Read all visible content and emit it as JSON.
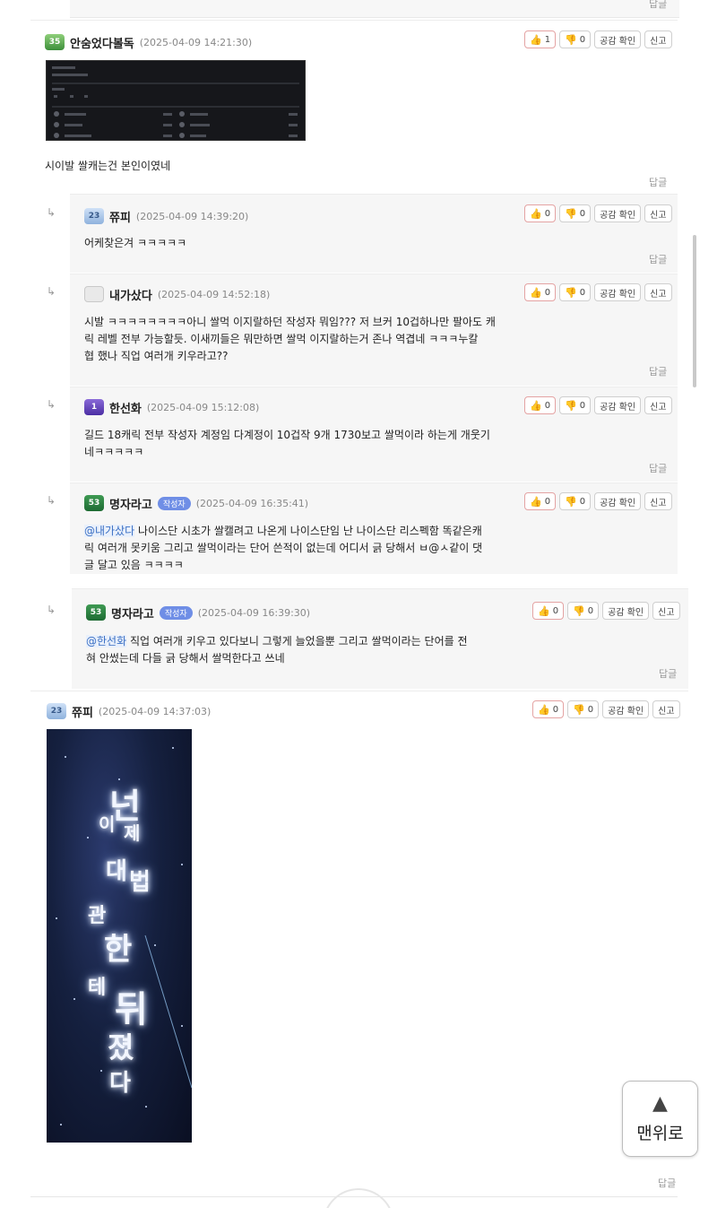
{
  "reply_label": "답글",
  "to_top": {
    "icon": "▲",
    "label": "맨위로"
  },
  "buttons": {
    "confirm": "공감 확인",
    "report": "신고",
    "like_icon": "thumbs-up-icon",
    "dislike_icon": "thumbs-down-icon"
  },
  "author_badge": "작성자",
  "comments": [
    {
      "level": "35",
      "nick": "안숨었다볼독",
      "date": "(2025-04-09 14:21:30)",
      "likes": "1",
      "dislikes": "0",
      "text": "시이발 쌀캐는건 본인이였네"
    },
    {
      "level": "23",
      "nick": "쮸피",
      "date": "(2025-04-09 14:39:20)",
      "likes": "0",
      "dislikes": "0",
      "text": "어케찾은겨 ㅋㅋㅋㅋㅋ"
    },
    {
      "level": "",
      "nick": "내가샀다",
      "date": "(2025-04-09 14:52:18)",
      "likes": "0",
      "dislikes": "0",
      "lines": [
        "시발 ㅋㅋㅋㅋㅋㅋㅋㅋ아니 쌀먹 이지랄하던 작성자 뭐임??? 저 브커 10겁하나만 팔아도 캐",
        "릭 레벨 전부 가능할듯. 이새끼들은 뭐만하면 쌀먹 이지랄하는거 존나 역겹네 ㅋㅋㅋ누칼",
        "협 했나 직업 여러개 키우라고??"
      ]
    },
    {
      "level": "1",
      "nick": "한선화",
      "date": "(2025-04-09 15:12:08)",
      "likes": "0",
      "dislikes": "0",
      "lines": [
        "길드 18캐릭 전부 작성자 계정임 다계정이 10겁작 9개 1730보고 쌀먹이라 하는게 개웃기",
        "네ㅋㅋㅋㅋㅋ"
      ]
    },
    {
      "level": "53",
      "nick": "명자라고",
      "date": "(2025-04-09 16:35:41)",
      "likes": "0",
      "dislikes": "0",
      "mention": "@내가샀다",
      "lines": [
        " 나이스단 시초가 쌀캘려고 나온게 나이스단임 난 나이스단 리스펙함 똑같은캐",
        "릭 여러개 못키움 그리고 쌀먹이라는 단어 쓴적이 없는데 어디서 긁 당해서 ㅂ@ㅅ같이 댓",
        "글 달고 있음 ㅋㅋㅋㅋ"
      ]
    },
    {
      "level": "53",
      "nick": "명자라고",
      "date": "(2025-04-09 16:39:30)",
      "likes": "0",
      "dislikes": "0",
      "mention": "@한선화",
      "lines": [
        " 직업 여러개 키우고 있다보니 그렇게 늘었을뿐  그리고 쌀먹이라는 단어를 전",
        "혀 안썼는데 다들 긁 당해서 쌀먹한다고 쓰네"
      ]
    },
    {
      "level": "23",
      "nick": "쮸피",
      "date": "(2025-04-09 14:37:03)",
      "likes": "0",
      "dislikes": "0"
    }
  ],
  "poster": {
    "glyphs": [
      "넌",
      "이",
      "제",
      "대",
      "법",
      "관",
      "한",
      "테",
      "뒤",
      "졌",
      "다"
    ]
  }
}
